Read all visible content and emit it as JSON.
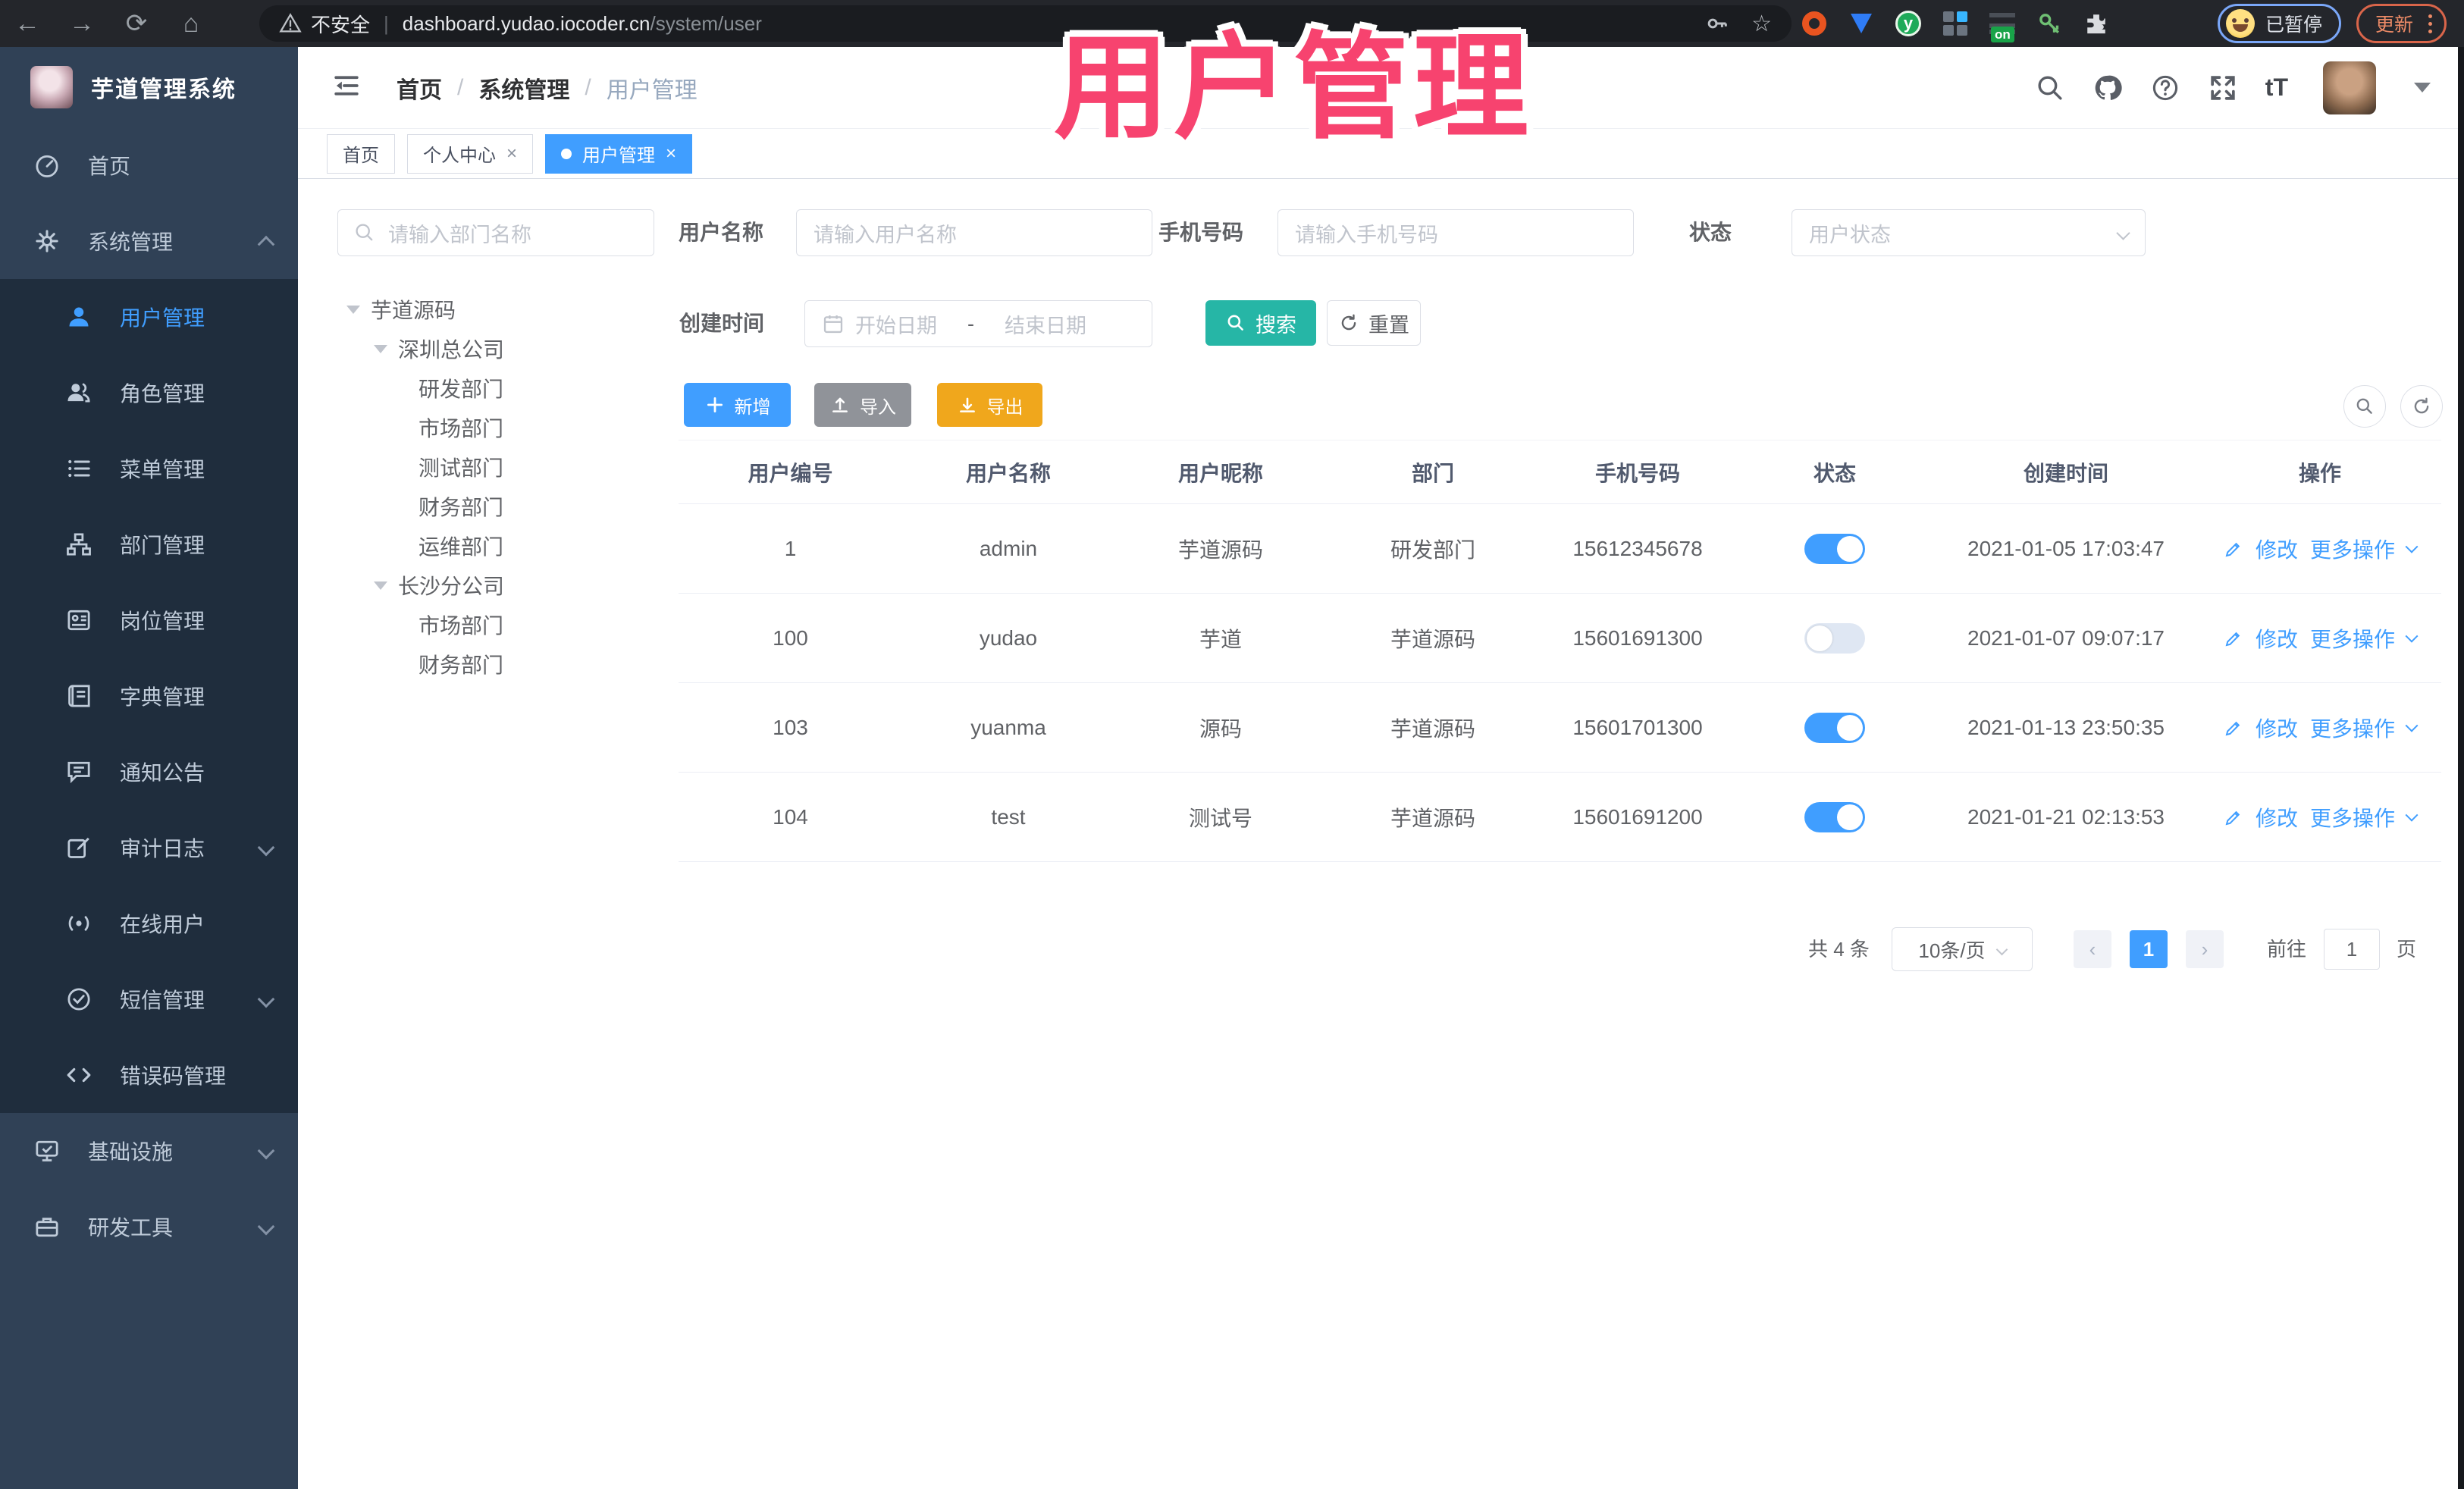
{
  "icons": {
    "close": "×",
    "back": "←",
    "forward": "→",
    "reload": "⟳",
    "home": "⌂",
    "star": "☆",
    "puzzle_hint": "puzzle"
  },
  "browser": {
    "security_label": "不安全",
    "url_host": "dashboard.yudao.iocoder.cn",
    "url_path": "/system/user",
    "extension_badge": "on",
    "extension_letter": "y",
    "profile_label": "已暂停",
    "update_label": "更新"
  },
  "overlay": {
    "text": "用户管理",
    "color": "#f7436f"
  },
  "sidebar": {
    "app_title": "芋道管理系统",
    "items": [
      {
        "label": "首页"
      },
      {
        "label": "系统管理"
      },
      {
        "label": "用户管理"
      },
      {
        "label": "角色管理"
      },
      {
        "label": "菜单管理"
      },
      {
        "label": "部门管理"
      },
      {
        "label": "岗位管理"
      },
      {
        "label": "字典管理"
      },
      {
        "label": "通知公告"
      },
      {
        "label": "审计日志"
      },
      {
        "label": "在线用户"
      },
      {
        "label": "短信管理"
      },
      {
        "label": "错误码管理"
      },
      {
        "label": "基础设施"
      },
      {
        "label": "研发工具"
      }
    ]
  },
  "header": {
    "breadcrumb": [
      "首页",
      "系统管理",
      "用户管理"
    ],
    "separator": "/",
    "help_glyph": "?",
    "font_size_glyph": "tT"
  },
  "tags": [
    {
      "label": "首页"
    },
    {
      "label": "个人中心"
    },
    {
      "label": "用户管理"
    }
  ],
  "dept_panel": {
    "search_placeholder": "请输入部门名称",
    "tree": [
      {
        "label": "芋道源码"
      },
      {
        "label": "深圳总公司"
      },
      {
        "label": "研发部门"
      },
      {
        "label": "市场部门"
      },
      {
        "label": "测试部门"
      },
      {
        "label": "财务部门"
      },
      {
        "label": "运维部门"
      },
      {
        "label": "长沙分公司"
      },
      {
        "label": "市场部门"
      },
      {
        "label": "财务部门"
      }
    ]
  },
  "filters": {
    "username_label": "用户名称",
    "username_placeholder": "请输入用户名称",
    "mobile_label": "手机号码",
    "mobile_placeholder": "请输入手机号码",
    "status_label": "状态",
    "status_placeholder": "用户状态",
    "create_time_label": "创建时间",
    "date_start_placeholder": "开始日期",
    "date_separator": "-",
    "date_end_placeholder": "结束日期",
    "search_label": "搜索",
    "reset_label": "重置"
  },
  "toolbar": {
    "add_label": "新增",
    "import_label": "导入",
    "export_label": "导出"
  },
  "table": {
    "columns": [
      "用户编号",
      "用户名称",
      "用户昵称",
      "部门",
      "手机号码",
      "状态",
      "创建时间",
      "操作"
    ],
    "actions": {
      "edit": "修改",
      "more": "更多操作"
    },
    "rows": [
      {
        "id": "1",
        "username": "admin",
        "nickname": "芋道源码",
        "dept": "研发部门",
        "mobile": "15612345678",
        "status": true,
        "created": "2021-01-05 17:03:47"
      },
      {
        "id": "100",
        "username": "yudao",
        "nickname": "芋道",
        "dept": "芋道源码",
        "mobile": "15601691300",
        "status": false,
        "created": "2021-01-07 09:07:17"
      },
      {
        "id": "103",
        "username": "yuanma",
        "nickname": "源码",
        "dept": "芋道源码",
        "mobile": "15601701300",
        "status": true,
        "created": "2021-01-13 23:50:35"
      },
      {
        "id": "104",
        "username": "test",
        "nickname": "测试号",
        "dept": "芋道源码",
        "mobile": "15601691200",
        "status": true,
        "created": "2021-01-21 02:13:53"
      }
    ]
  },
  "pagination": {
    "total": "共 4 条",
    "page_size": "10条/页",
    "prev": "‹",
    "next": "›",
    "current": "1",
    "goto_label": "前往",
    "goto_value": "1",
    "page_label": "页"
  }
}
